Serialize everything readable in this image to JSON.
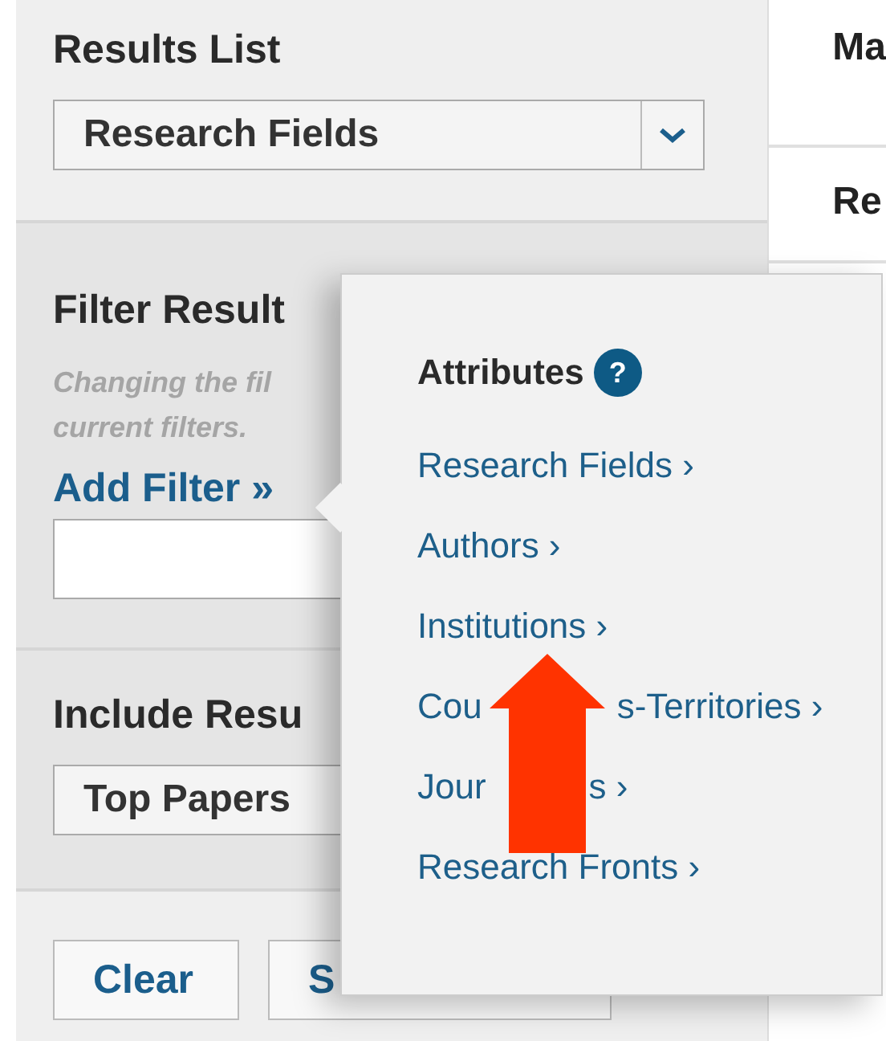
{
  "sidebar": {
    "results_list": {
      "title": "Results List",
      "select": {
        "value": "Research Fields"
      }
    },
    "filter": {
      "title": "Filter Result",
      "hint_lines": [
        "Changing the fil",
        "current filters."
      ],
      "add_filter": "Add Filter »"
    },
    "include": {
      "title": "Include Resu",
      "select": {
        "value": "Top Papers"
      }
    },
    "buttons": [
      "Clear",
      "S"
    ]
  },
  "main": {
    "headings": [
      "Ma",
      "Re"
    ]
  },
  "popup": {
    "title": "Attributes",
    "help": "?",
    "items": [
      {
        "parts": [
          "Research Fields ›"
        ]
      },
      {
        "parts": [
          "Authors ›"
        ]
      },
      {
        "parts": [
          "Institutions ›"
        ]
      },
      {
        "parts": [
          "Cou",
          "s-Territories ›"
        ]
      },
      {
        "parts": [
          "Jour",
          "s ›"
        ]
      },
      {
        "parts": [
          "Research Fronts ›"
        ]
      }
    ]
  }
}
